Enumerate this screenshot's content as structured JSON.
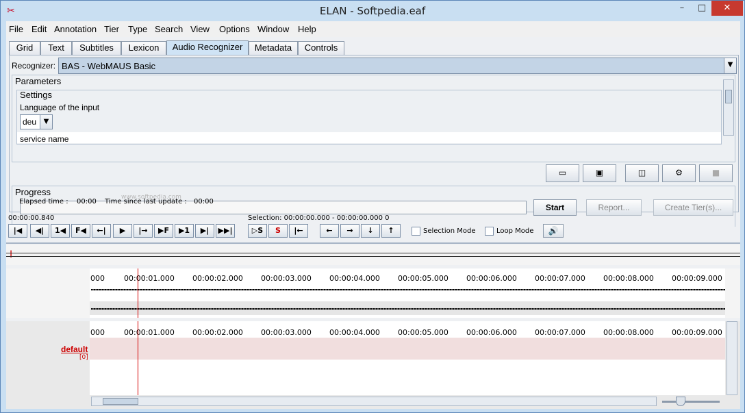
{
  "window": {
    "title": "ELAN - Softpedia.eaf",
    "minimize": "–",
    "maximize": "□",
    "close": "✕"
  },
  "menu": [
    "File",
    "Edit",
    "Annotation",
    "Tier",
    "Type",
    "Search",
    "View",
    "Options",
    "Window",
    "Help"
  ],
  "tabs": [
    "Grid",
    "Text",
    "Subtitles",
    "Lexicon",
    "Audio Recognizer",
    "Metadata",
    "Controls"
  ],
  "active_tab": "Audio Recognizer",
  "recognizer": {
    "label": "Recognizer:",
    "value": "BAS - WebMAUS Basic"
  },
  "parameters": {
    "title": "Parameters",
    "settings_title": "Settings",
    "language_label": "Language of the input",
    "language_value": "deu",
    "service_label": "service name"
  },
  "progress": {
    "title": "Progress",
    "start_button": "Start",
    "report_button": "Report...",
    "create_tiers_button": "Create Tier(s)...",
    "elapsed_label": "Elapsed time :",
    "elapsed_value": "00:00",
    "since_label": "Time since last update :",
    "since_value": "00:00",
    "watermark": "www.softpedia.com"
  },
  "media": {
    "current_time": "00:00:00.840",
    "selection": "Selection: 00:00:00.000 - 00:00:00.000  0",
    "buttons": [
      "|◀",
      "◀|",
      "1◀",
      "F◀",
      "←|",
      "▶",
      "|→",
      "▶F",
      "▶1",
      "▶|",
      "▶▶|"
    ],
    "selection_buttons": [
      "▷S",
      "S",
      "|←"
    ],
    "nav_buttons": [
      "←",
      "→",
      "↓",
      "↑"
    ],
    "selection_mode": "Selection Mode",
    "loop_mode": "Loop Mode"
  },
  "ruler_labels": [
    "000",
    "00:00:01.000",
    "00:00:02.000",
    "00:00:03.000",
    "00:00:04.000",
    "00:00:05.000",
    "00:00:06.000",
    "00:00:07.000",
    "00:00:08.000",
    "00:00:09.000"
  ],
  "tier": {
    "name": "default",
    "count": "[0]"
  }
}
